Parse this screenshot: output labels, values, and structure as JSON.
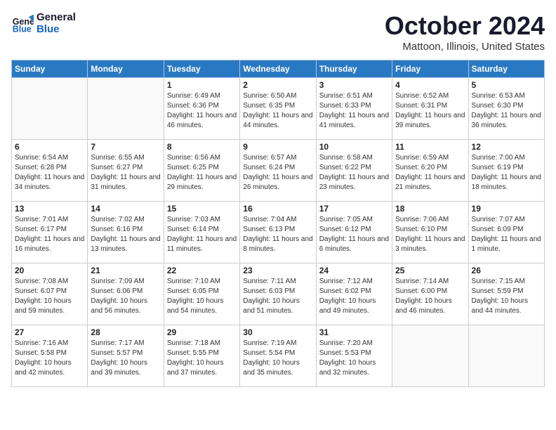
{
  "header": {
    "logo_line1": "General",
    "logo_line2": "Blue",
    "month": "October 2024",
    "location": "Mattoon, Illinois, United States"
  },
  "days_of_week": [
    "Sunday",
    "Monday",
    "Tuesday",
    "Wednesday",
    "Thursday",
    "Friday",
    "Saturday"
  ],
  "weeks": [
    [
      {
        "day": "",
        "info": ""
      },
      {
        "day": "",
        "info": ""
      },
      {
        "day": "1",
        "info": "Sunrise: 6:49 AM\nSunset: 6:36 PM\nDaylight: 11 hours and 46 minutes."
      },
      {
        "day": "2",
        "info": "Sunrise: 6:50 AM\nSunset: 6:35 PM\nDaylight: 11 hours and 44 minutes."
      },
      {
        "day": "3",
        "info": "Sunrise: 6:51 AM\nSunset: 6:33 PM\nDaylight: 11 hours and 41 minutes."
      },
      {
        "day": "4",
        "info": "Sunrise: 6:52 AM\nSunset: 6:31 PM\nDaylight: 11 hours and 39 minutes."
      },
      {
        "day": "5",
        "info": "Sunrise: 6:53 AM\nSunset: 6:30 PM\nDaylight: 11 hours and 36 minutes."
      }
    ],
    [
      {
        "day": "6",
        "info": "Sunrise: 6:54 AM\nSunset: 6:28 PM\nDaylight: 11 hours and 34 minutes."
      },
      {
        "day": "7",
        "info": "Sunrise: 6:55 AM\nSunset: 6:27 PM\nDaylight: 11 hours and 31 minutes."
      },
      {
        "day": "8",
        "info": "Sunrise: 6:56 AM\nSunset: 6:25 PM\nDaylight: 11 hours and 29 minutes."
      },
      {
        "day": "9",
        "info": "Sunrise: 6:57 AM\nSunset: 6:24 PM\nDaylight: 11 hours and 26 minutes."
      },
      {
        "day": "10",
        "info": "Sunrise: 6:58 AM\nSunset: 6:22 PM\nDaylight: 11 hours and 23 minutes."
      },
      {
        "day": "11",
        "info": "Sunrise: 6:59 AM\nSunset: 6:20 PM\nDaylight: 11 hours and 21 minutes."
      },
      {
        "day": "12",
        "info": "Sunrise: 7:00 AM\nSunset: 6:19 PM\nDaylight: 11 hours and 18 minutes."
      }
    ],
    [
      {
        "day": "13",
        "info": "Sunrise: 7:01 AM\nSunset: 6:17 PM\nDaylight: 11 hours and 16 minutes."
      },
      {
        "day": "14",
        "info": "Sunrise: 7:02 AM\nSunset: 6:16 PM\nDaylight: 11 hours and 13 minutes."
      },
      {
        "day": "15",
        "info": "Sunrise: 7:03 AM\nSunset: 6:14 PM\nDaylight: 11 hours and 11 minutes."
      },
      {
        "day": "16",
        "info": "Sunrise: 7:04 AM\nSunset: 6:13 PM\nDaylight: 11 hours and 8 minutes."
      },
      {
        "day": "17",
        "info": "Sunrise: 7:05 AM\nSunset: 6:12 PM\nDaylight: 11 hours and 6 minutes."
      },
      {
        "day": "18",
        "info": "Sunrise: 7:06 AM\nSunset: 6:10 PM\nDaylight: 11 hours and 3 minutes."
      },
      {
        "day": "19",
        "info": "Sunrise: 7:07 AM\nSunset: 6:09 PM\nDaylight: 11 hours and 1 minute."
      }
    ],
    [
      {
        "day": "20",
        "info": "Sunrise: 7:08 AM\nSunset: 6:07 PM\nDaylight: 10 hours and 59 minutes."
      },
      {
        "day": "21",
        "info": "Sunrise: 7:09 AM\nSunset: 6:06 PM\nDaylight: 10 hours and 56 minutes."
      },
      {
        "day": "22",
        "info": "Sunrise: 7:10 AM\nSunset: 6:05 PM\nDaylight: 10 hours and 54 minutes."
      },
      {
        "day": "23",
        "info": "Sunrise: 7:11 AM\nSunset: 6:03 PM\nDaylight: 10 hours and 51 minutes."
      },
      {
        "day": "24",
        "info": "Sunrise: 7:12 AM\nSunset: 6:02 PM\nDaylight: 10 hours and 49 minutes."
      },
      {
        "day": "25",
        "info": "Sunrise: 7:14 AM\nSunset: 6:00 PM\nDaylight: 10 hours and 46 minutes."
      },
      {
        "day": "26",
        "info": "Sunrise: 7:15 AM\nSunset: 5:59 PM\nDaylight: 10 hours and 44 minutes."
      }
    ],
    [
      {
        "day": "27",
        "info": "Sunrise: 7:16 AM\nSunset: 5:58 PM\nDaylight: 10 hours and 42 minutes."
      },
      {
        "day": "28",
        "info": "Sunrise: 7:17 AM\nSunset: 5:57 PM\nDaylight: 10 hours and 39 minutes."
      },
      {
        "day": "29",
        "info": "Sunrise: 7:18 AM\nSunset: 5:55 PM\nDaylight: 10 hours and 37 minutes."
      },
      {
        "day": "30",
        "info": "Sunrise: 7:19 AM\nSunset: 5:54 PM\nDaylight: 10 hours and 35 minutes."
      },
      {
        "day": "31",
        "info": "Sunrise: 7:20 AM\nSunset: 5:53 PM\nDaylight: 10 hours and 32 minutes."
      },
      {
        "day": "",
        "info": ""
      },
      {
        "day": "",
        "info": ""
      }
    ]
  ]
}
